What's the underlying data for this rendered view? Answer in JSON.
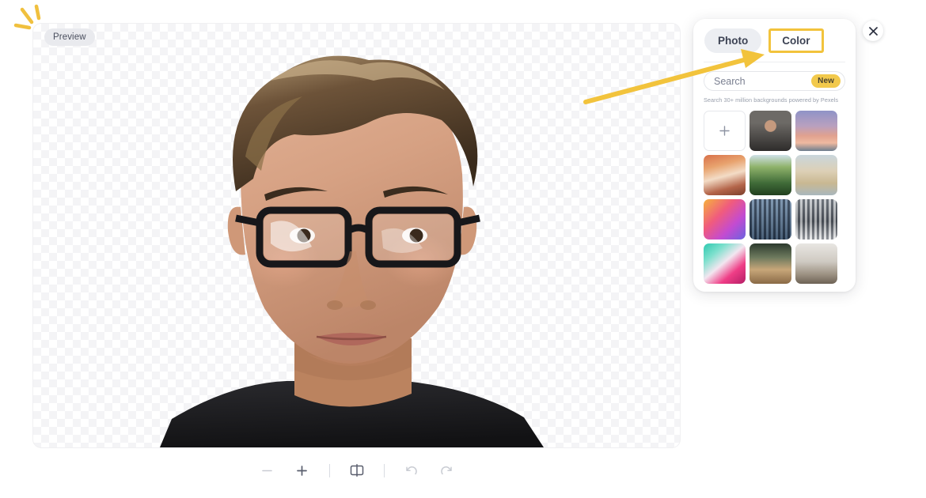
{
  "canvas": {
    "preview_badge": "Preview",
    "subject_alt": "cutout-portrait"
  },
  "toolbar": {
    "zoom_out": "zoom-out",
    "zoom_in": "zoom-in",
    "compare": "compare-split",
    "undo": "undo",
    "redo": "redo"
  },
  "panel": {
    "tabs": [
      {
        "label": "Photo",
        "state": "active"
      },
      {
        "label": "Color",
        "state": "highlighted"
      }
    ],
    "search": {
      "placeholder": "Search",
      "value": "",
      "badge": "New"
    },
    "caption": "Search 30+ million backgrounds powered by Pexels",
    "grid": [
      {
        "name": "upload",
        "label": "+",
        "kind": "upload"
      },
      {
        "name": "thumb-portrait",
        "kind": "photo",
        "art": "t-portrait"
      },
      {
        "name": "thumb-sunset-sky",
        "kind": "photo",
        "art": "t-sunset"
      },
      {
        "name": "thumb-canyon",
        "kind": "photo",
        "art": "t-canyon"
      },
      {
        "name": "thumb-jungle",
        "kind": "photo",
        "art": "t-jungle"
      },
      {
        "name": "thumb-ruins",
        "kind": "photo",
        "art": "t-ruin"
      },
      {
        "name": "thumb-gradient",
        "kind": "photo",
        "art": "t-gradient"
      },
      {
        "name": "thumb-tower-blocks",
        "kind": "photo",
        "art": "t-tower"
      },
      {
        "name": "thumb-corridor",
        "kind": "photo",
        "art": "t-hall"
      },
      {
        "name": "thumb-aqua-abstract",
        "kind": "photo",
        "art": "t-aqua"
      },
      {
        "name": "thumb-cafe-interior",
        "kind": "photo",
        "art": "t-cafe"
      },
      {
        "name": "thumb-studio-interior",
        "kind": "photo",
        "art": "t-studio"
      }
    ]
  },
  "close": {
    "label": "✕"
  },
  "colors": {
    "accent_yellow": "#f2c33c",
    "badge_yellow": "#f2c94c",
    "tab_active_bg": "#eceef2",
    "text_primary": "#3d4354",
    "text_muted": "#9aa0ad"
  }
}
